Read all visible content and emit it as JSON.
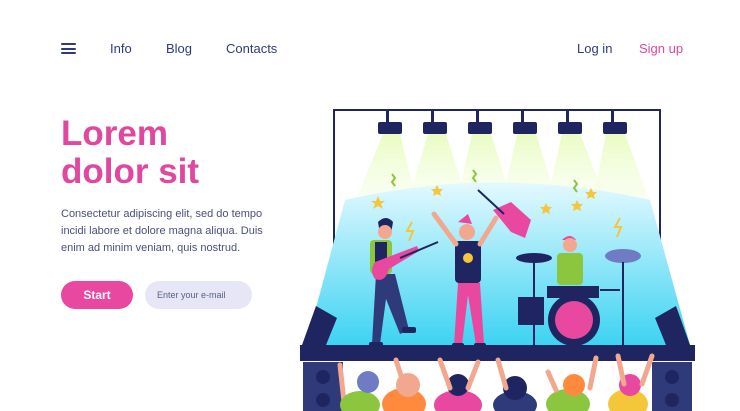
{
  "nav": {
    "menu_icon": "hamburger-menu-icon",
    "links": [
      "Info",
      "Blog",
      "Contacts"
    ],
    "login": "Log in",
    "signup": "Sign up"
  },
  "hero": {
    "title_line1": "Lorem",
    "title_line2": "dolor sit",
    "body": "Consectetur adipiscing elit, sed do tempo incidi labore et dolore magna aliqua. Duis enim ad minim veniam, quis nostrud.",
    "start_label": "Start",
    "email_placeholder": "Enter your e-mail"
  },
  "colors": {
    "accent": "#e0479e",
    "nav_text": "#2f3a7a",
    "input_bg": "#e6e6f6",
    "stage_light": "#b6f06a",
    "stage_blue": "#4ad8f4"
  }
}
